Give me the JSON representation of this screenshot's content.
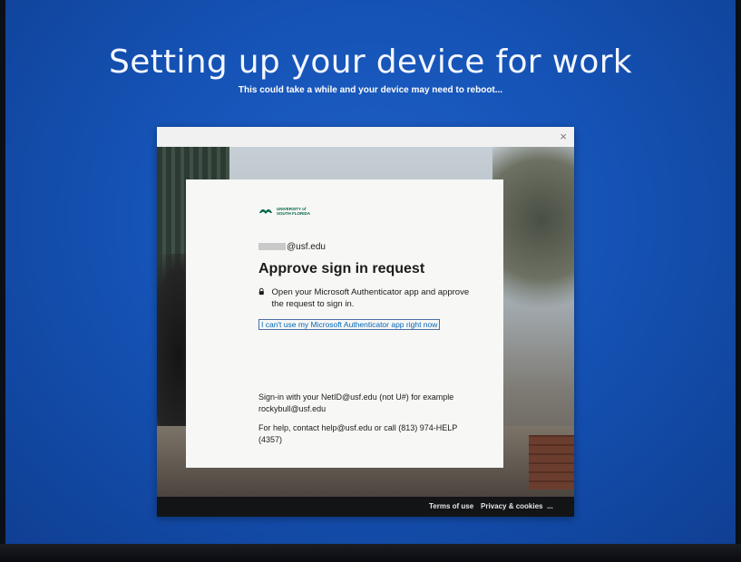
{
  "screen": {
    "headline": "Setting up your device for work",
    "subline": "This could take a while and your device may need to reboot..."
  },
  "dialog": {
    "close_symbol": "×",
    "logo": {
      "line1": "UNIVERSITY of",
      "line2": "SOUTH FLORIDA",
      "brand_color": "#006747"
    },
    "email_domain": "@usf.edu",
    "title": "Approve sign in request",
    "lock_icon": "lock-icon",
    "description": "Open your Microsoft Authenticator app and approve the request to sign in.",
    "cant_use_link": "I can't use my Microsoft Authenticator app right now",
    "info_netid": "Sign-in with your NetID@usf.edu (not U#) for example rockybull@usf.edu",
    "info_help": "For help, contact help@usf.edu or call (813) 974-HELP (4357)",
    "footer": {
      "terms": "Terms of use",
      "privacy": "Privacy & cookies",
      "more": "..."
    }
  }
}
